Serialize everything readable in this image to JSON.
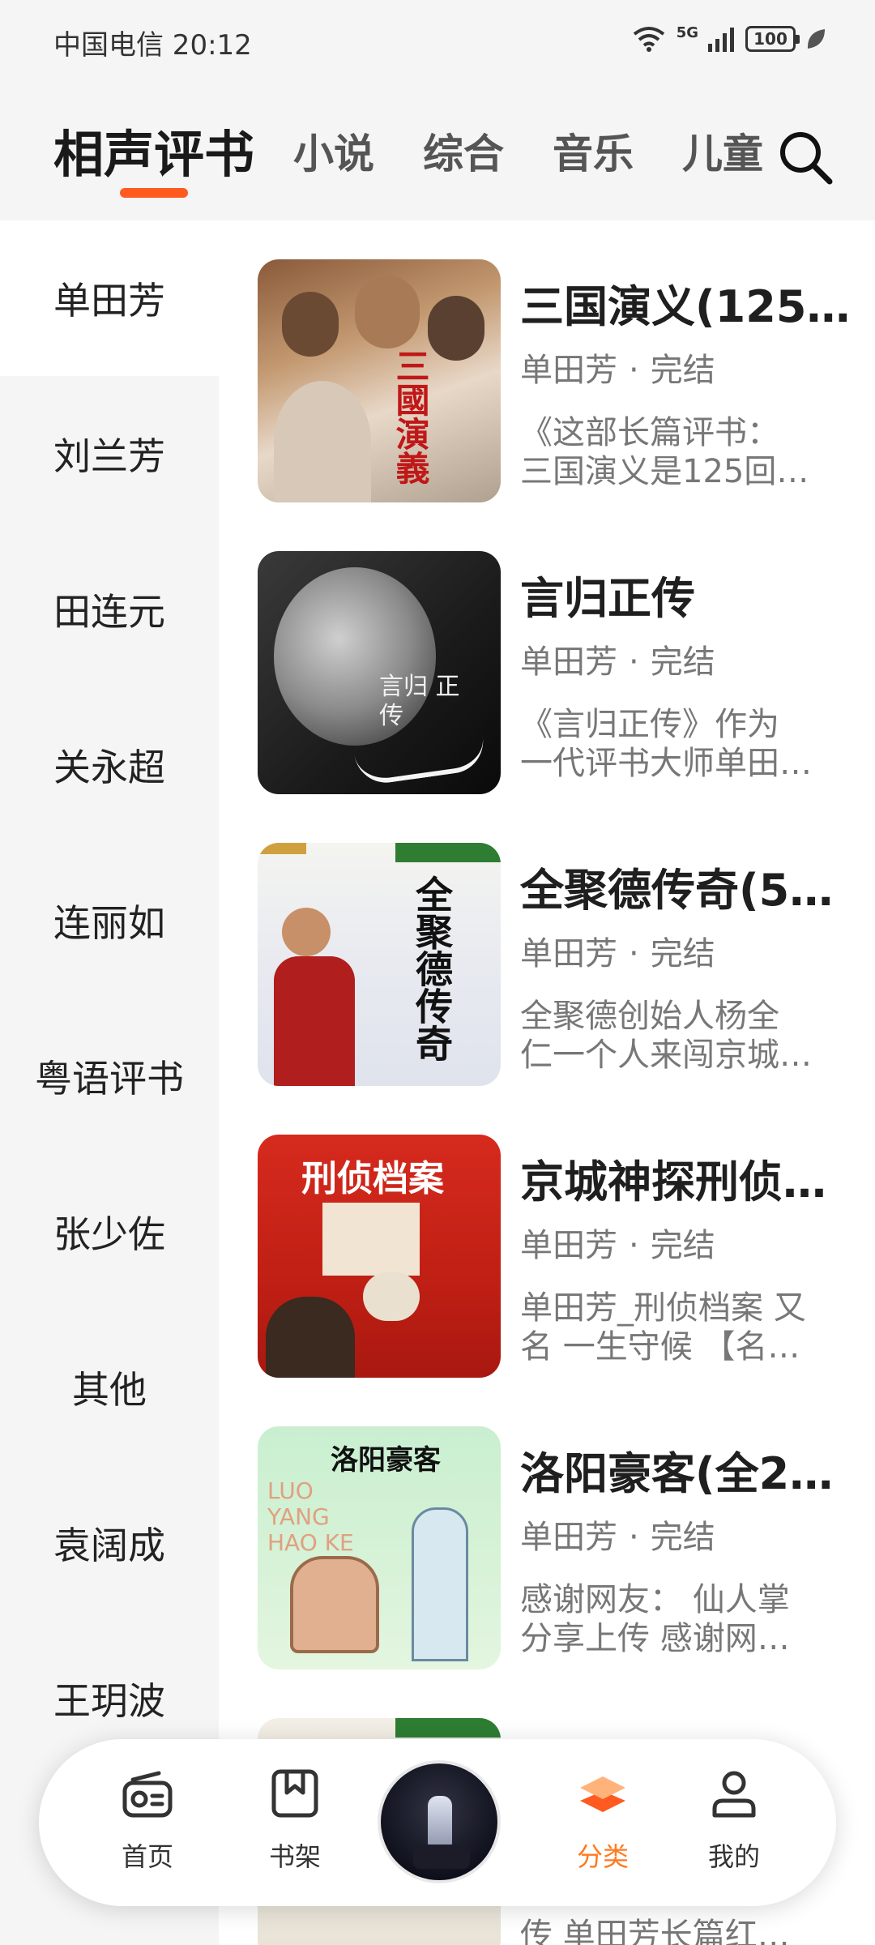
{
  "status_bar": {
    "carrier_time": "中国电信 20:12",
    "network": "5G",
    "battery": "100"
  },
  "top_tabs": [
    {
      "label": "相声评书",
      "active": true
    },
    {
      "label": "小说",
      "active": false
    },
    {
      "label": "综合",
      "active": false
    },
    {
      "label": "音乐",
      "active": false
    },
    {
      "label": "儿童",
      "active": false
    }
  ],
  "sidebar": {
    "items": [
      {
        "label": "单田芳",
        "active": true
      },
      {
        "label": "刘兰芳"
      },
      {
        "label": "田连元"
      },
      {
        "label": "关永超"
      },
      {
        "label": "连丽如"
      },
      {
        "label": "粤语评书"
      },
      {
        "label": "张少佐"
      },
      {
        "label": "其他"
      },
      {
        "label": "袁阔成"
      },
      {
        "label": "王玥波"
      }
    ]
  },
  "books": [
    {
      "title": "三国演义(125…",
      "author": "单田芳",
      "status": "完结",
      "desc_line1": "《这部长篇评书：",
      "desc_line2": "三国演义是125回…",
      "cover_text": "三國演義"
    },
    {
      "title": "言归正传",
      "author": "单田芳",
      "status": "完结",
      "desc_line1": "《言归正传》作为",
      "desc_line2": "一代评书大师单田…",
      "cover_text": "言归 正传"
    },
    {
      "title": "全聚德传奇(5…",
      "author": "单田芳",
      "status": "完结",
      "desc_line1": "全聚德创始人杨全",
      "desc_line2": "仁一个人来闯京城…",
      "cover_text": "全聚德传奇"
    },
    {
      "title": "京城神探刑侦…",
      "author": "单田芳",
      "status": "完结",
      "desc_line1": "单田芳_刑侦档案 又",
      "desc_line2": "名 一生守候 【名…",
      "cover_text": "刑侦档案"
    },
    {
      "title": "洛阳豪客(全2…",
      "author": "单田芳",
      "status": "完结",
      "desc_line1": "感谢网友： 仙人掌",
      "desc_line2": "分享上传 感谢网…",
      "cover_text": "洛阳豪客",
      "cover_subtext": "LUO YANG HAO KE"
    },
    {
      "desc_line2": "传 单田芳长篇红…"
    }
  ],
  "bottom_nav": {
    "items": [
      {
        "label": "首页",
        "icon": "radio-icon"
      },
      {
        "label": "书架",
        "icon": "bookmark-icon"
      },
      {
        "label": "分类",
        "icon": "layers-icon",
        "active": true
      },
      {
        "label": "我的",
        "icon": "user-icon"
      }
    ]
  },
  "colors": {
    "accent": "#ff5a1f",
    "active_nav": "#ff7a1f",
    "sidebar_bg": "#f5f5f5"
  }
}
